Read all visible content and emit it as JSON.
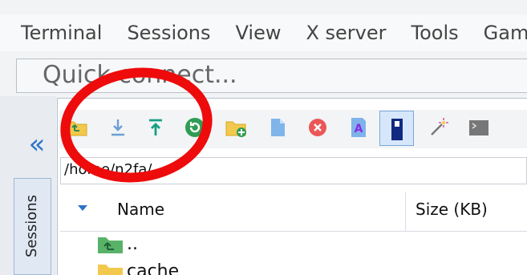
{
  "menu": {
    "items": [
      "Terminal",
      "Sessions",
      "View",
      "X server",
      "Tools",
      "Games"
    ]
  },
  "quick_connect": {
    "placeholder": "Quick connect..."
  },
  "sidebar": {
    "sessions_label": "Sessions"
  },
  "file_browser": {
    "path": "/home/n2fa/",
    "columns": {
      "name": "Name",
      "size": "Size (KB)"
    },
    "rows": [
      {
        "name": "..",
        "icon": "parent-folder-icon"
      },
      {
        "name": "cache",
        "icon": "folder-icon"
      }
    ]
  },
  "toolbar": {
    "icons": [
      "parent-folder-icon",
      "download-icon",
      "upload-icon",
      "refresh-icon",
      "new-folder-icon",
      "new-file-icon",
      "delete-icon",
      "rename-icon",
      "follow-terminal-icon",
      "settings-wand-icon",
      "terminal-icon"
    ]
  },
  "colors": {
    "highlight_circle": "#ee0b0b",
    "accent_blue": "#2b74c7",
    "folder_yellow": "#f2c94c",
    "green": "#2f9d55",
    "teal": "#16a085",
    "red": "#eb5757"
  }
}
